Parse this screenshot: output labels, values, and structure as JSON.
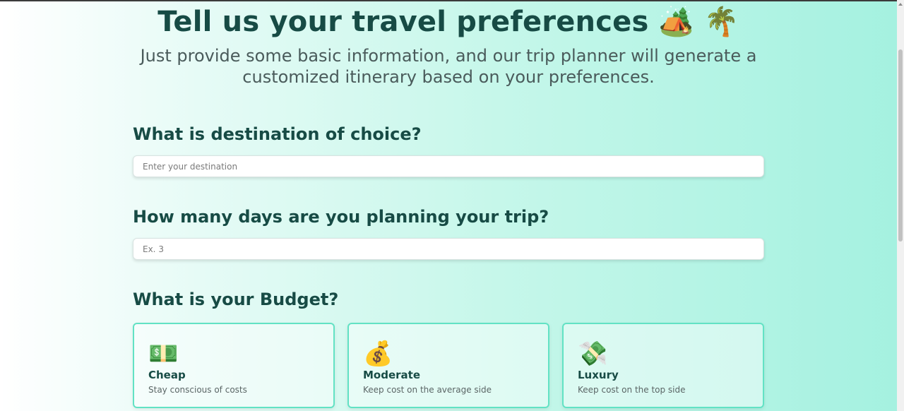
{
  "hero": {
    "title": "Tell us your travel preferences",
    "title_emoji": "🏕️ 🌴",
    "subtitle_line1": "Just provide some basic information, and our trip planner will generate a",
    "subtitle_line2": "customized itinerary based on your preferences."
  },
  "destination": {
    "label": "What is destination of choice?",
    "placeholder": "Enter your destination",
    "value": ""
  },
  "days": {
    "label": "How many days are you planning your trip?",
    "placeholder": "Ex. 3",
    "value": ""
  },
  "budget": {
    "label": "What is your Budget?",
    "options": [
      {
        "icon": "💵",
        "icon_name": "dollar-banknote-icon",
        "title": "Cheap",
        "description": "Stay conscious of costs"
      },
      {
        "icon": "💰",
        "icon_name": "money-bag-icon",
        "title": "Moderate",
        "description": "Keep cost on the average side"
      },
      {
        "icon": "💸",
        "icon_name": "money-with-wings-icon",
        "title": "Luxury",
        "description": "Keep cost on the top side"
      }
    ]
  },
  "colors": {
    "heading": "#174b45",
    "card_border": "#62e2c4",
    "background_end": "#a4f1e0"
  }
}
